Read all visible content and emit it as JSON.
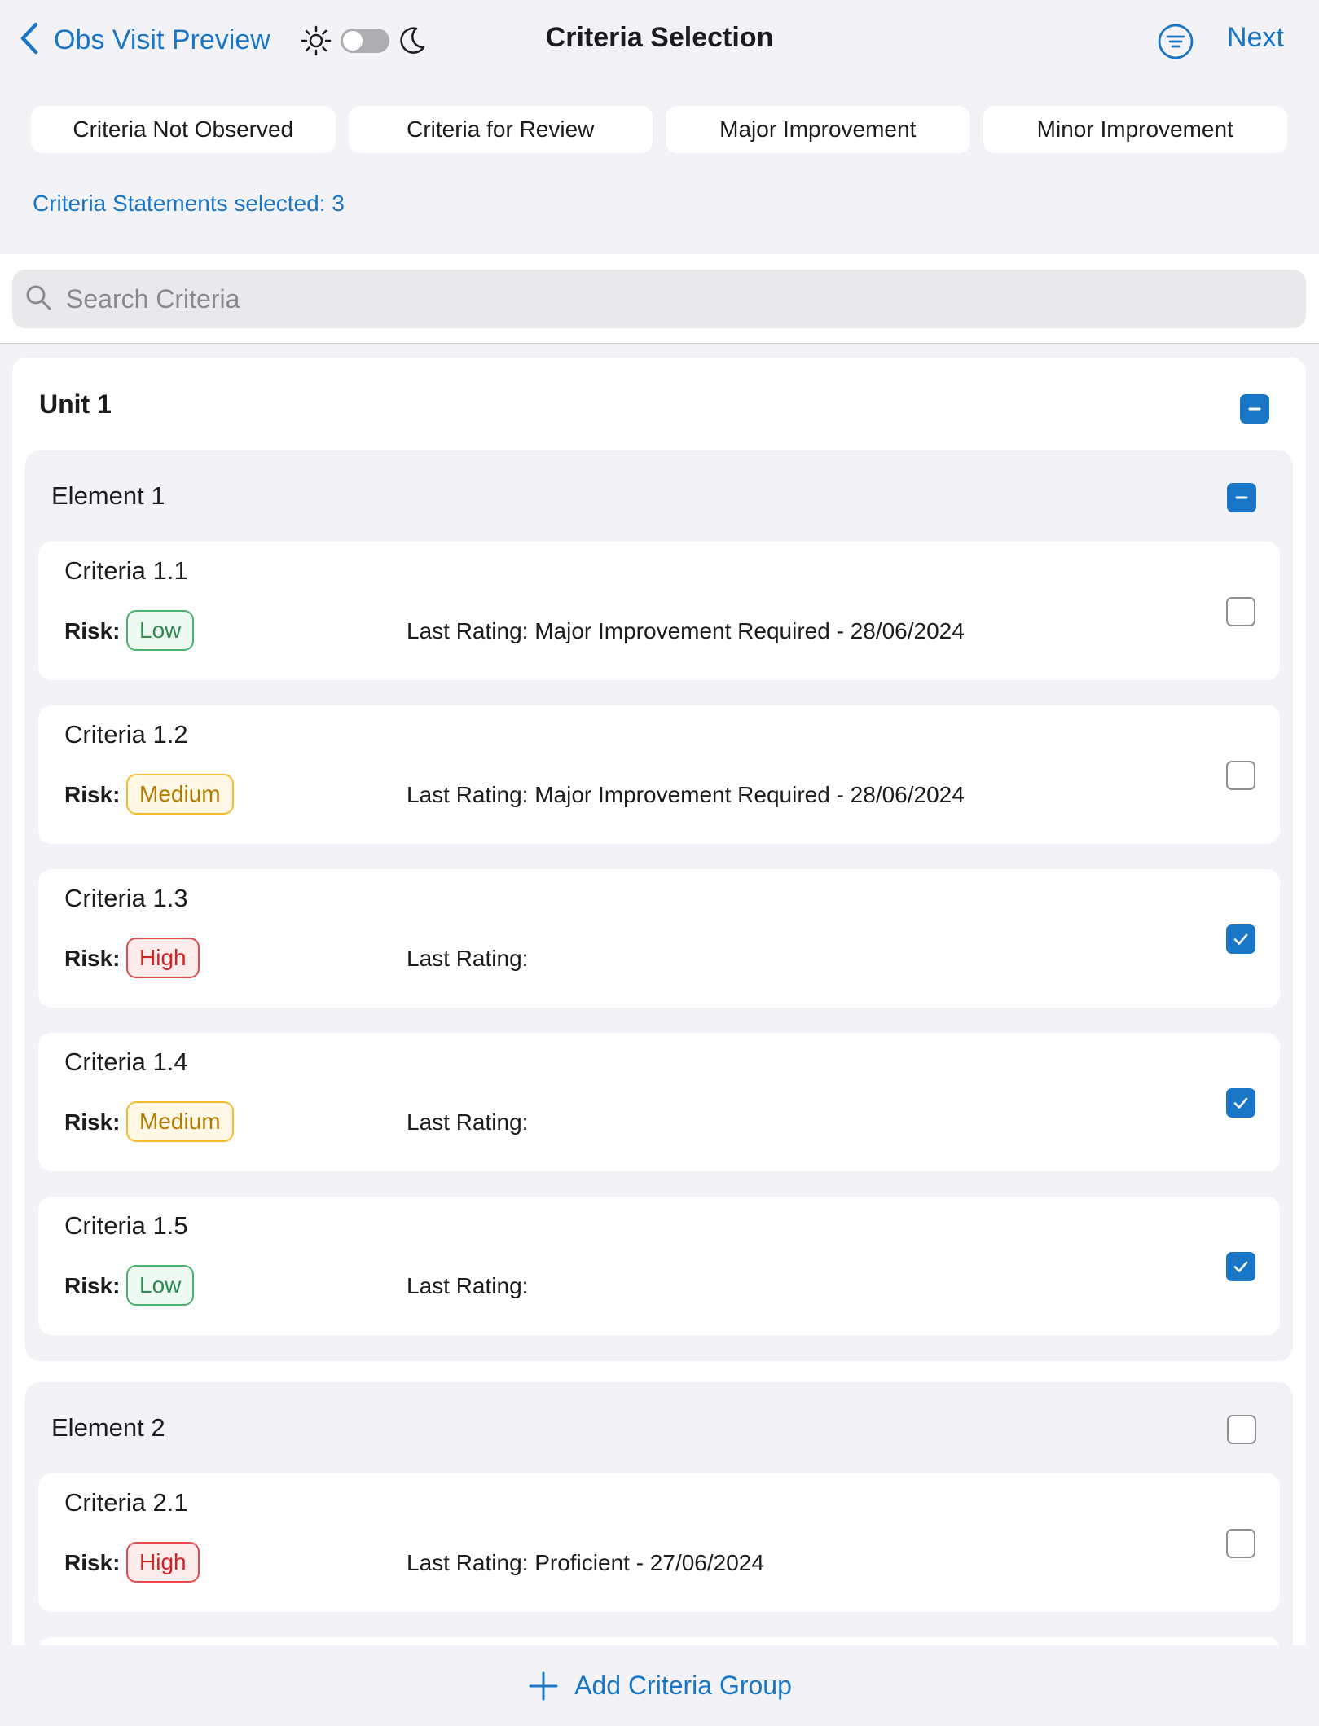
{
  "nav": {
    "back_label": "Obs Visit Preview",
    "title": "Criteria Selection",
    "next_label": "Next",
    "theme_icons": [
      "sun-icon",
      "moon-icon"
    ],
    "filter_icon": "filter-list-icon"
  },
  "chips": [
    {
      "label": "Criteria Not Observed"
    },
    {
      "label": "Criteria for Review"
    },
    {
      "label": "Major Improvement"
    },
    {
      "label": "Minor Improvement"
    }
  ],
  "selected_count": "Criteria Statements selected: 3",
  "search": {
    "placeholder": "Search Criteria",
    "value": ""
  },
  "unit": {
    "title": "Unit 1",
    "state": "mixed",
    "elements": [
      {
        "title": "Element 1",
        "state": "mixed",
        "criteria": [
          {
            "title": "Criteria 1.1",
            "risk_label": "Risk:",
            "risk": "Low",
            "last_rating": "Last Rating: Major Improvement Required - 28/06/2024",
            "checked": false
          },
          {
            "title": "Criteria 1.2",
            "risk_label": "Risk:",
            "risk": "Medium",
            "last_rating": "Last Rating: Major Improvement Required - 28/06/2024",
            "checked": false
          },
          {
            "title": "Criteria 1.3",
            "risk_label": "Risk:",
            "risk": "High",
            "last_rating": "Last Rating:",
            "checked": true
          },
          {
            "title": "Criteria 1.4",
            "risk_label": "Risk:",
            "risk": "Medium",
            "last_rating": "Last Rating:",
            "checked": true
          },
          {
            "title": "Criteria 1.5",
            "risk_label": "Risk:",
            "risk": "Low",
            "last_rating": "Last Rating:",
            "checked": true
          }
        ]
      },
      {
        "title": "Element 2",
        "state": "unchecked",
        "criteria": [
          {
            "title": "Criteria 2.1",
            "risk_label": "Risk:",
            "risk": "High",
            "last_rating": "Last Rating: Proficient - 27/06/2024",
            "checked": false
          }
        ]
      }
    ]
  },
  "bottom": {
    "add_label": "Add Criteria Group"
  },
  "colors": {
    "accent": "#1976c6",
    "risk_low": "#2e8b4e",
    "risk_medium": "#b47a00",
    "risk_high": "#d42020",
    "background": "#f2f2f7"
  }
}
